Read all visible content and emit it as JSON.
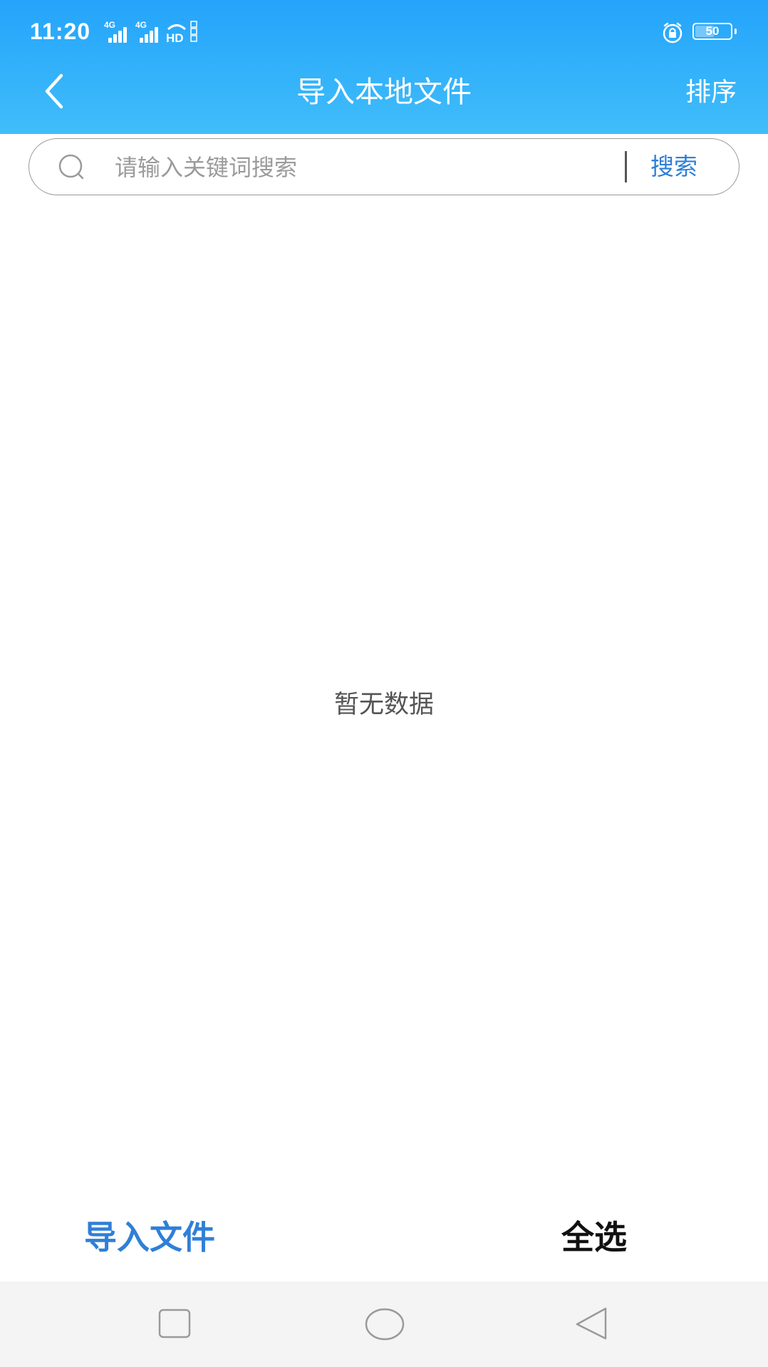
{
  "status_bar": {
    "time": "11:20",
    "signal_1_label": "4G",
    "signal_2_label": "4G",
    "hd_label": "HD",
    "battery": "50",
    "icons": [
      "signal-icon",
      "signal-icon",
      "hd-volte-icon",
      "alarm-lock-icon",
      "battery-icon"
    ]
  },
  "nav": {
    "back_icon": "chevron-left-icon",
    "title": "导入本地文件",
    "sort_label": "排序"
  },
  "search": {
    "icon": "search-icon",
    "placeholder": "请输入关键词搜索",
    "value": "",
    "button_label": "搜索"
  },
  "main": {
    "empty_text": "暂无数据"
  },
  "actions": {
    "import_label": "导入文件",
    "select_all_label": "全选"
  },
  "system_nav": {
    "icons": [
      "recent-apps-icon",
      "home-icon",
      "back-triangle-icon"
    ]
  },
  "colors": {
    "header_top": "#24a4fb",
    "header_bottom": "#40bdfa",
    "accent_blue": "#2f7fd8",
    "nav_bar_bg": "#f4f4f4"
  }
}
